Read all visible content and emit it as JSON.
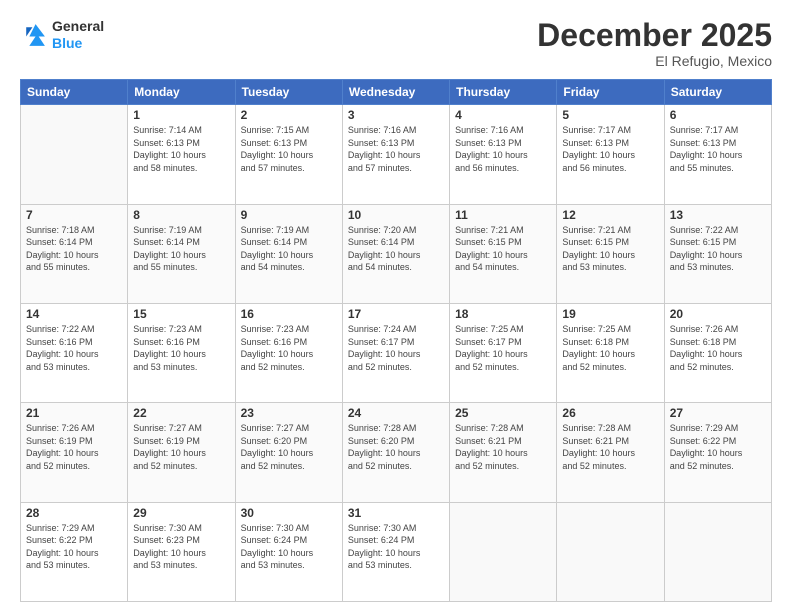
{
  "header": {
    "logo_general": "General",
    "logo_blue": "Blue",
    "month": "December 2025",
    "location": "El Refugio, Mexico"
  },
  "days_of_week": [
    "Sunday",
    "Monday",
    "Tuesday",
    "Wednesday",
    "Thursday",
    "Friday",
    "Saturday"
  ],
  "weeks": [
    [
      {
        "num": "",
        "info": ""
      },
      {
        "num": "1",
        "info": "Sunrise: 7:14 AM\nSunset: 6:13 PM\nDaylight: 10 hours\nand 58 minutes."
      },
      {
        "num": "2",
        "info": "Sunrise: 7:15 AM\nSunset: 6:13 PM\nDaylight: 10 hours\nand 57 minutes."
      },
      {
        "num": "3",
        "info": "Sunrise: 7:16 AM\nSunset: 6:13 PM\nDaylight: 10 hours\nand 57 minutes."
      },
      {
        "num": "4",
        "info": "Sunrise: 7:16 AM\nSunset: 6:13 PM\nDaylight: 10 hours\nand 56 minutes."
      },
      {
        "num": "5",
        "info": "Sunrise: 7:17 AM\nSunset: 6:13 PM\nDaylight: 10 hours\nand 56 minutes."
      },
      {
        "num": "6",
        "info": "Sunrise: 7:17 AM\nSunset: 6:13 PM\nDaylight: 10 hours\nand 55 minutes."
      }
    ],
    [
      {
        "num": "7",
        "info": "Sunrise: 7:18 AM\nSunset: 6:14 PM\nDaylight: 10 hours\nand 55 minutes."
      },
      {
        "num": "8",
        "info": "Sunrise: 7:19 AM\nSunset: 6:14 PM\nDaylight: 10 hours\nand 55 minutes."
      },
      {
        "num": "9",
        "info": "Sunrise: 7:19 AM\nSunset: 6:14 PM\nDaylight: 10 hours\nand 54 minutes."
      },
      {
        "num": "10",
        "info": "Sunrise: 7:20 AM\nSunset: 6:14 PM\nDaylight: 10 hours\nand 54 minutes."
      },
      {
        "num": "11",
        "info": "Sunrise: 7:21 AM\nSunset: 6:15 PM\nDaylight: 10 hours\nand 54 minutes."
      },
      {
        "num": "12",
        "info": "Sunrise: 7:21 AM\nSunset: 6:15 PM\nDaylight: 10 hours\nand 53 minutes."
      },
      {
        "num": "13",
        "info": "Sunrise: 7:22 AM\nSunset: 6:15 PM\nDaylight: 10 hours\nand 53 minutes."
      }
    ],
    [
      {
        "num": "14",
        "info": "Sunrise: 7:22 AM\nSunset: 6:16 PM\nDaylight: 10 hours\nand 53 minutes."
      },
      {
        "num": "15",
        "info": "Sunrise: 7:23 AM\nSunset: 6:16 PM\nDaylight: 10 hours\nand 53 minutes."
      },
      {
        "num": "16",
        "info": "Sunrise: 7:23 AM\nSunset: 6:16 PM\nDaylight: 10 hours\nand 52 minutes."
      },
      {
        "num": "17",
        "info": "Sunrise: 7:24 AM\nSunset: 6:17 PM\nDaylight: 10 hours\nand 52 minutes."
      },
      {
        "num": "18",
        "info": "Sunrise: 7:25 AM\nSunset: 6:17 PM\nDaylight: 10 hours\nand 52 minutes."
      },
      {
        "num": "19",
        "info": "Sunrise: 7:25 AM\nSunset: 6:18 PM\nDaylight: 10 hours\nand 52 minutes."
      },
      {
        "num": "20",
        "info": "Sunrise: 7:26 AM\nSunset: 6:18 PM\nDaylight: 10 hours\nand 52 minutes."
      }
    ],
    [
      {
        "num": "21",
        "info": "Sunrise: 7:26 AM\nSunset: 6:19 PM\nDaylight: 10 hours\nand 52 minutes."
      },
      {
        "num": "22",
        "info": "Sunrise: 7:27 AM\nSunset: 6:19 PM\nDaylight: 10 hours\nand 52 minutes."
      },
      {
        "num": "23",
        "info": "Sunrise: 7:27 AM\nSunset: 6:20 PM\nDaylight: 10 hours\nand 52 minutes."
      },
      {
        "num": "24",
        "info": "Sunrise: 7:28 AM\nSunset: 6:20 PM\nDaylight: 10 hours\nand 52 minutes."
      },
      {
        "num": "25",
        "info": "Sunrise: 7:28 AM\nSunset: 6:21 PM\nDaylight: 10 hours\nand 52 minutes."
      },
      {
        "num": "26",
        "info": "Sunrise: 7:28 AM\nSunset: 6:21 PM\nDaylight: 10 hours\nand 52 minutes."
      },
      {
        "num": "27",
        "info": "Sunrise: 7:29 AM\nSunset: 6:22 PM\nDaylight: 10 hours\nand 52 minutes."
      }
    ],
    [
      {
        "num": "28",
        "info": "Sunrise: 7:29 AM\nSunset: 6:22 PM\nDaylight: 10 hours\nand 53 minutes."
      },
      {
        "num": "29",
        "info": "Sunrise: 7:30 AM\nSunset: 6:23 PM\nDaylight: 10 hours\nand 53 minutes."
      },
      {
        "num": "30",
        "info": "Sunrise: 7:30 AM\nSunset: 6:24 PM\nDaylight: 10 hours\nand 53 minutes."
      },
      {
        "num": "31",
        "info": "Sunrise: 7:30 AM\nSunset: 6:24 PM\nDaylight: 10 hours\nand 53 minutes."
      },
      {
        "num": "",
        "info": ""
      },
      {
        "num": "",
        "info": ""
      },
      {
        "num": "",
        "info": ""
      }
    ]
  ]
}
